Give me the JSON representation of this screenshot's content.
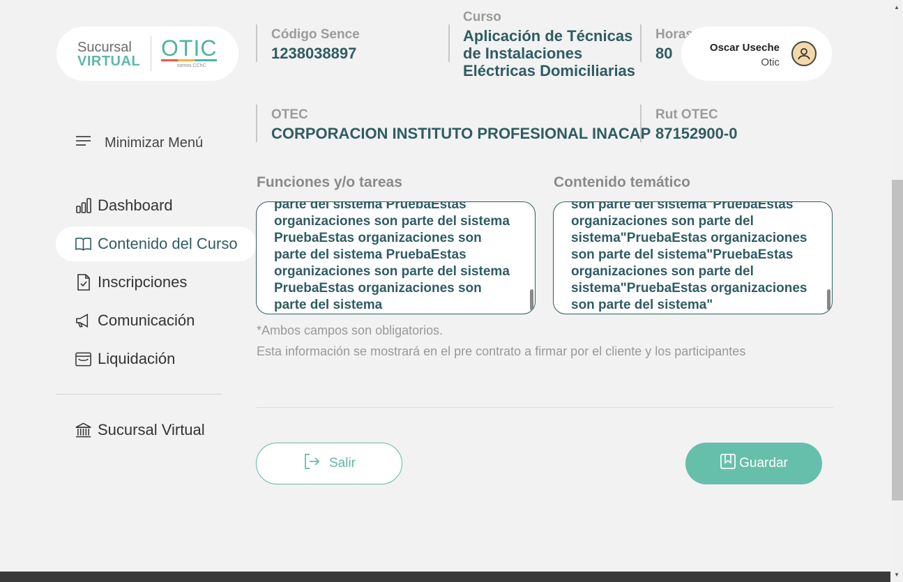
{
  "logo": {
    "line1": "Sucursal",
    "line2": "VIRTUAL",
    "brand": "OTIC",
    "sub": "somos CChC"
  },
  "course": {
    "codigo_label": "Código Sence",
    "codigo_value": "1238038897",
    "curso_label": "Curso",
    "curso_value": "Aplicación de Técnicas de Instalaciones Eléctricas Domiciliarias",
    "horas_label": "Horas",
    "horas_value": "80",
    "otec_label": "OTEC",
    "otec_value": "CORPORACION INSTITUTO PROFESIONAL INACAP",
    "rut_label": "Rut OTEC",
    "rut_value": "87152900-0"
  },
  "user": {
    "name": "Oscar Useche",
    "role": "Otic",
    "icon": "user-avatar-icon"
  },
  "sidebar": {
    "minimize_label": "Minimizar Menú",
    "items": [
      {
        "label": "Dashboard",
        "icon": "bar-chart-icon"
      },
      {
        "label": "Contenido del Curso",
        "icon": "book-icon",
        "active": true
      },
      {
        "label": "Inscripciones",
        "icon": "document-check-icon"
      },
      {
        "label": "Comunicación",
        "icon": "megaphone-icon"
      },
      {
        "label": "Liquidación",
        "icon": "wallet-icon"
      }
    ],
    "bottom_item": {
      "label": "Sucursal Virtual",
      "icon": "bank-icon"
    }
  },
  "form": {
    "funciones_label": "Funciones y/o tareas",
    "funciones_text": "parte del sistema PruebaEstas\norganizaciones son parte del sistema\nPruebaEstas organizaciones son\nparte del sistema PruebaEstas\norganizaciones son parte del sistema\nPruebaEstas organizaciones son\nparte del sistema",
    "contenido_label": "Contenido temático",
    "contenido_text": "son parte del sistema\"PruebaEstas\norganizaciones son parte del\nsistema\"PruebaEstas organizaciones\nson parte del sistema\"PruebaEstas\norganizaciones son parte del\nsistema\"PruebaEstas organizaciones\nson parte del sistema\"",
    "note_required": "*Ambos campos son obligatorios.",
    "note_info": "Esta información se mostrará en el pre contrato a firmar por el cliente y los participantes"
  },
  "actions": {
    "salir_label": "Salir",
    "guardar_label": "Guardar"
  },
  "colors": {
    "accent": "#66bfab",
    "text_dark": "#2f5c63",
    "label_gray": "#9b9b9b"
  }
}
